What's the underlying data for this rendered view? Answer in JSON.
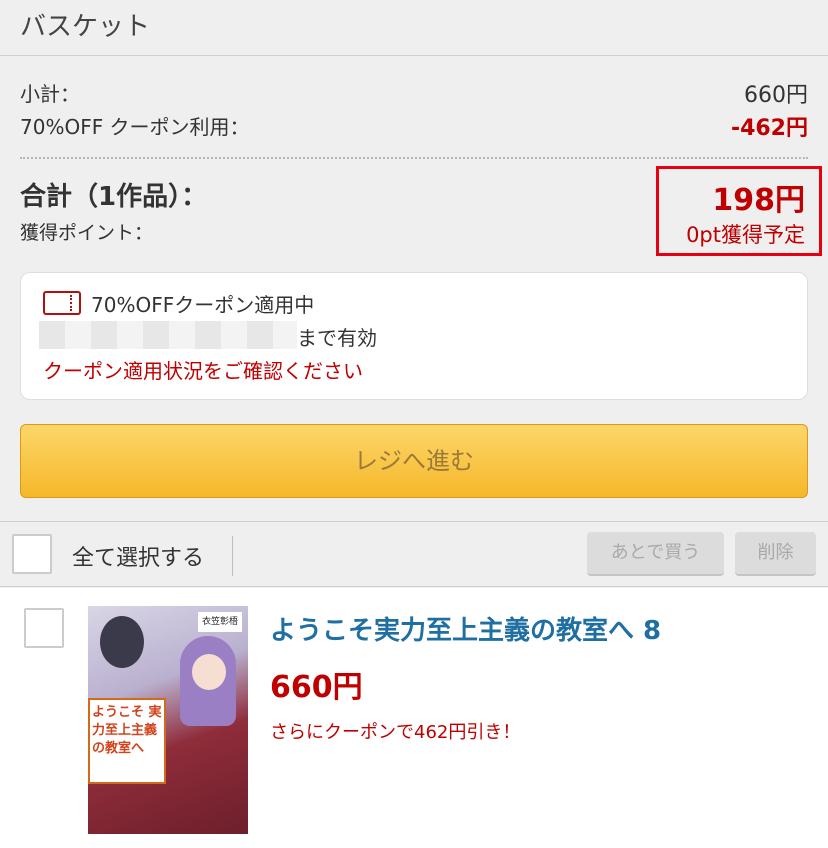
{
  "header": {
    "title": "バスケット"
  },
  "summary": {
    "subtotal_label": "小計：",
    "subtotal_value": "660円",
    "coupon_label": "70%OFF クーポン利用：",
    "coupon_value": "-462円",
    "total_label": "合計（1作品）：",
    "points_label": "獲得ポイント：",
    "total_value": "198円",
    "points_value": "0pt獲得予定"
  },
  "coupon": {
    "name": "70%OFFクーポン適用中",
    "valid_until": "まで有効",
    "confirm_link": "クーポン適用状況をご確認ください"
  },
  "checkout": {
    "label": "レジへ進む"
  },
  "selection": {
    "select_all": "全て選択する",
    "later_button": "あとで買う",
    "delete_button": "削除"
  },
  "item": {
    "title": "ようこそ実力至上主義の教室へ 8",
    "price": "660円",
    "coupon_note": "さらにクーポンで462円引き！",
    "cover_title": "ようこそ 実力至上主義 の教室へ",
    "cover_author": "衣笠彰梧"
  },
  "colors": {
    "accent_red": "#c00000",
    "link_blue": "#1f6fa3",
    "button_yellow": "#f6b72a"
  }
}
